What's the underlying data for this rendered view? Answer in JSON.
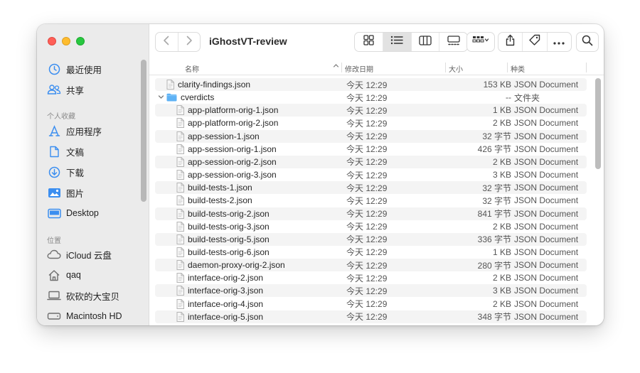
{
  "window": {
    "title": "iGhostVT-review"
  },
  "sidebar": {
    "favorites": [
      {
        "label": "最近使用",
        "icon": "clock-icon"
      },
      {
        "label": "共享",
        "icon": "shared-people-icon"
      }
    ],
    "section_personal": "个人收藏",
    "personal": [
      {
        "label": "应用程序",
        "icon": "applications-icon"
      },
      {
        "label": "文稿",
        "icon": "document-icon"
      },
      {
        "label": "下载",
        "icon": "download-icon"
      },
      {
        "label": "图片",
        "icon": "pictures-icon"
      },
      {
        "label": "Desktop",
        "icon": "desktop-icon"
      }
    ],
    "section_locations": "位置",
    "locations": [
      {
        "label": "iCloud 云盘",
        "icon": "cloud-icon"
      },
      {
        "label": "qaq",
        "icon": "home-icon"
      },
      {
        "label": "砍砍的大宝贝",
        "icon": "laptop-icon"
      },
      {
        "label": "Macintosh HD",
        "icon": "disk-icon"
      }
    ]
  },
  "columns": {
    "name": "名称",
    "date": "修改日期",
    "size": "大小",
    "kind": "种类"
  },
  "rows": [
    {
      "name": "clarity-findings.json",
      "date": "今天 12:29",
      "size": "153 KB",
      "kind": "JSON Document",
      "type": "file",
      "indent": 0
    },
    {
      "name": "cverdicts",
      "date": "今天 12:29",
      "size": "--",
      "kind": "文件夹",
      "type": "folder",
      "indent": 0
    },
    {
      "name": "app-platform-orig-1.json",
      "date": "今天 12:29",
      "size": "1 KB",
      "kind": "JSON Document",
      "type": "file",
      "indent": 1
    },
    {
      "name": "app-platform-orig-2.json",
      "date": "今天 12:29",
      "size": "2 KB",
      "kind": "JSON Document",
      "type": "file",
      "indent": 1
    },
    {
      "name": "app-session-1.json",
      "date": "今天 12:29",
      "size": "32 字节",
      "kind": "JSON Document",
      "type": "file",
      "indent": 1
    },
    {
      "name": "app-session-orig-1.json",
      "date": "今天 12:29",
      "size": "426 字节",
      "kind": "JSON Document",
      "type": "file",
      "indent": 1
    },
    {
      "name": "app-session-orig-2.json",
      "date": "今天 12:29",
      "size": "2 KB",
      "kind": "JSON Document",
      "type": "file",
      "indent": 1
    },
    {
      "name": "app-session-orig-3.json",
      "date": "今天 12:29",
      "size": "3 KB",
      "kind": "JSON Document",
      "type": "file",
      "indent": 1
    },
    {
      "name": "build-tests-1.json",
      "date": "今天 12:29",
      "size": "32 字节",
      "kind": "JSON Document",
      "type": "file",
      "indent": 1
    },
    {
      "name": "build-tests-2.json",
      "date": "今天 12:29",
      "size": "32 字节",
      "kind": "JSON Document",
      "type": "file",
      "indent": 1
    },
    {
      "name": "build-tests-orig-2.json",
      "date": "今天 12:29",
      "size": "841 字节",
      "kind": "JSON Document",
      "type": "file",
      "indent": 1
    },
    {
      "name": "build-tests-orig-3.json",
      "date": "今天 12:29",
      "size": "2 KB",
      "kind": "JSON Document",
      "type": "file",
      "indent": 1
    },
    {
      "name": "build-tests-orig-5.json",
      "date": "今天 12:29",
      "size": "336 字节",
      "kind": "JSON Document",
      "type": "file",
      "indent": 1
    },
    {
      "name": "build-tests-orig-6.json",
      "date": "今天 12:29",
      "size": "1 KB",
      "kind": "JSON Document",
      "type": "file",
      "indent": 1
    },
    {
      "name": "daemon-proxy-orig-2.json",
      "date": "今天 12:29",
      "size": "280 字节",
      "kind": "JSON Document",
      "type": "file",
      "indent": 1
    },
    {
      "name": "interface-orig-2.json",
      "date": "今天 12:29",
      "size": "2 KB",
      "kind": "JSON Document",
      "type": "file",
      "indent": 1
    },
    {
      "name": "interface-orig-3.json",
      "date": "今天 12:29",
      "size": "3 KB",
      "kind": "JSON Document",
      "type": "file",
      "indent": 1
    },
    {
      "name": "interface-orig-4.json",
      "date": "今天 12:29",
      "size": "2 KB",
      "kind": "JSON Document",
      "type": "file",
      "indent": 1
    },
    {
      "name": "interface-orig-5.json",
      "date": "今天 12:29",
      "size": "348 字节",
      "kind": "JSON Document",
      "type": "file",
      "indent": 1
    }
  ],
  "colors": {
    "accent": "#3b8ef0",
    "folder": "#5eb2f5",
    "close": "#ff5f57",
    "minimize": "#febc2e",
    "zoom": "#28c840"
  }
}
